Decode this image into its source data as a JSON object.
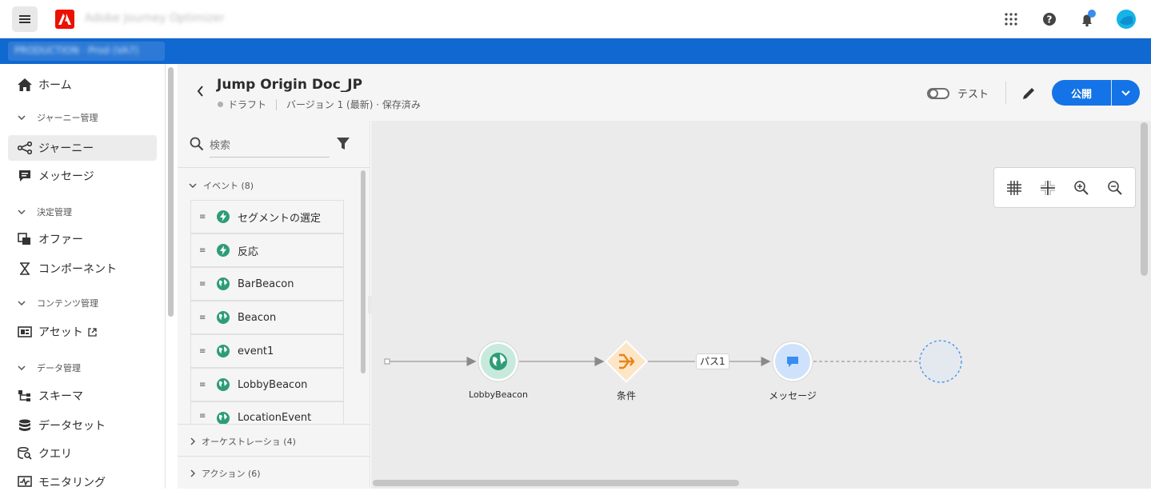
{
  "topbar": {
    "app_title": "Adobe Journey Optimizer",
    "icons": [
      "menu-icon",
      "adobe-logo",
      "apps-grid-icon",
      "help-icon",
      "notification-bell-icon",
      "user-avatar"
    ]
  },
  "org_bar": {
    "org_text": "PRODUCTION · Prod (VA7)"
  },
  "nav": {
    "home": "ホーム",
    "journey_mgmt": "ジャーニー管理",
    "journeys": "ジャーニー",
    "messages": "メッセージ",
    "decision_mgmt": "決定管理",
    "offers": "オファー",
    "components": "コンポーネント",
    "content_mgmt": "コンテンツ管理",
    "assets": "アセット",
    "data_mgmt": "データ管理",
    "schemas": "スキーマ",
    "datasets": "データセット",
    "queries": "クエリ",
    "monitoring": "モニタリング"
  },
  "header": {
    "title": "Jump Origin Doc_JP",
    "status": "ドラフト",
    "version": "バージョン 1 (最新) · 保存済み",
    "test_label": "テスト",
    "publish_label": "公開"
  },
  "palette": {
    "search_placeholder": "検索",
    "events_category": "イベント (8)",
    "events": [
      "セグメントの選定",
      "反応",
      "BarBeacon",
      "Beacon",
      "event1",
      "LobbyBeacon",
      "LocationEvent"
    ],
    "orchestration_category": "オーケストレーショ (4)",
    "actions_category": "アクション (6)"
  },
  "canvas": {
    "node_event_label": "LobbyBeacon",
    "node_condition_label": "条件",
    "path_label": "パス1",
    "node_message_label": "メッセージ"
  },
  "colors": {
    "brand_blue": "#1068d1",
    "publish_blue": "#1473e6",
    "event_green": "#2d9d78",
    "condition_orange": "#e68619",
    "message_blue": "#378ef0"
  }
}
